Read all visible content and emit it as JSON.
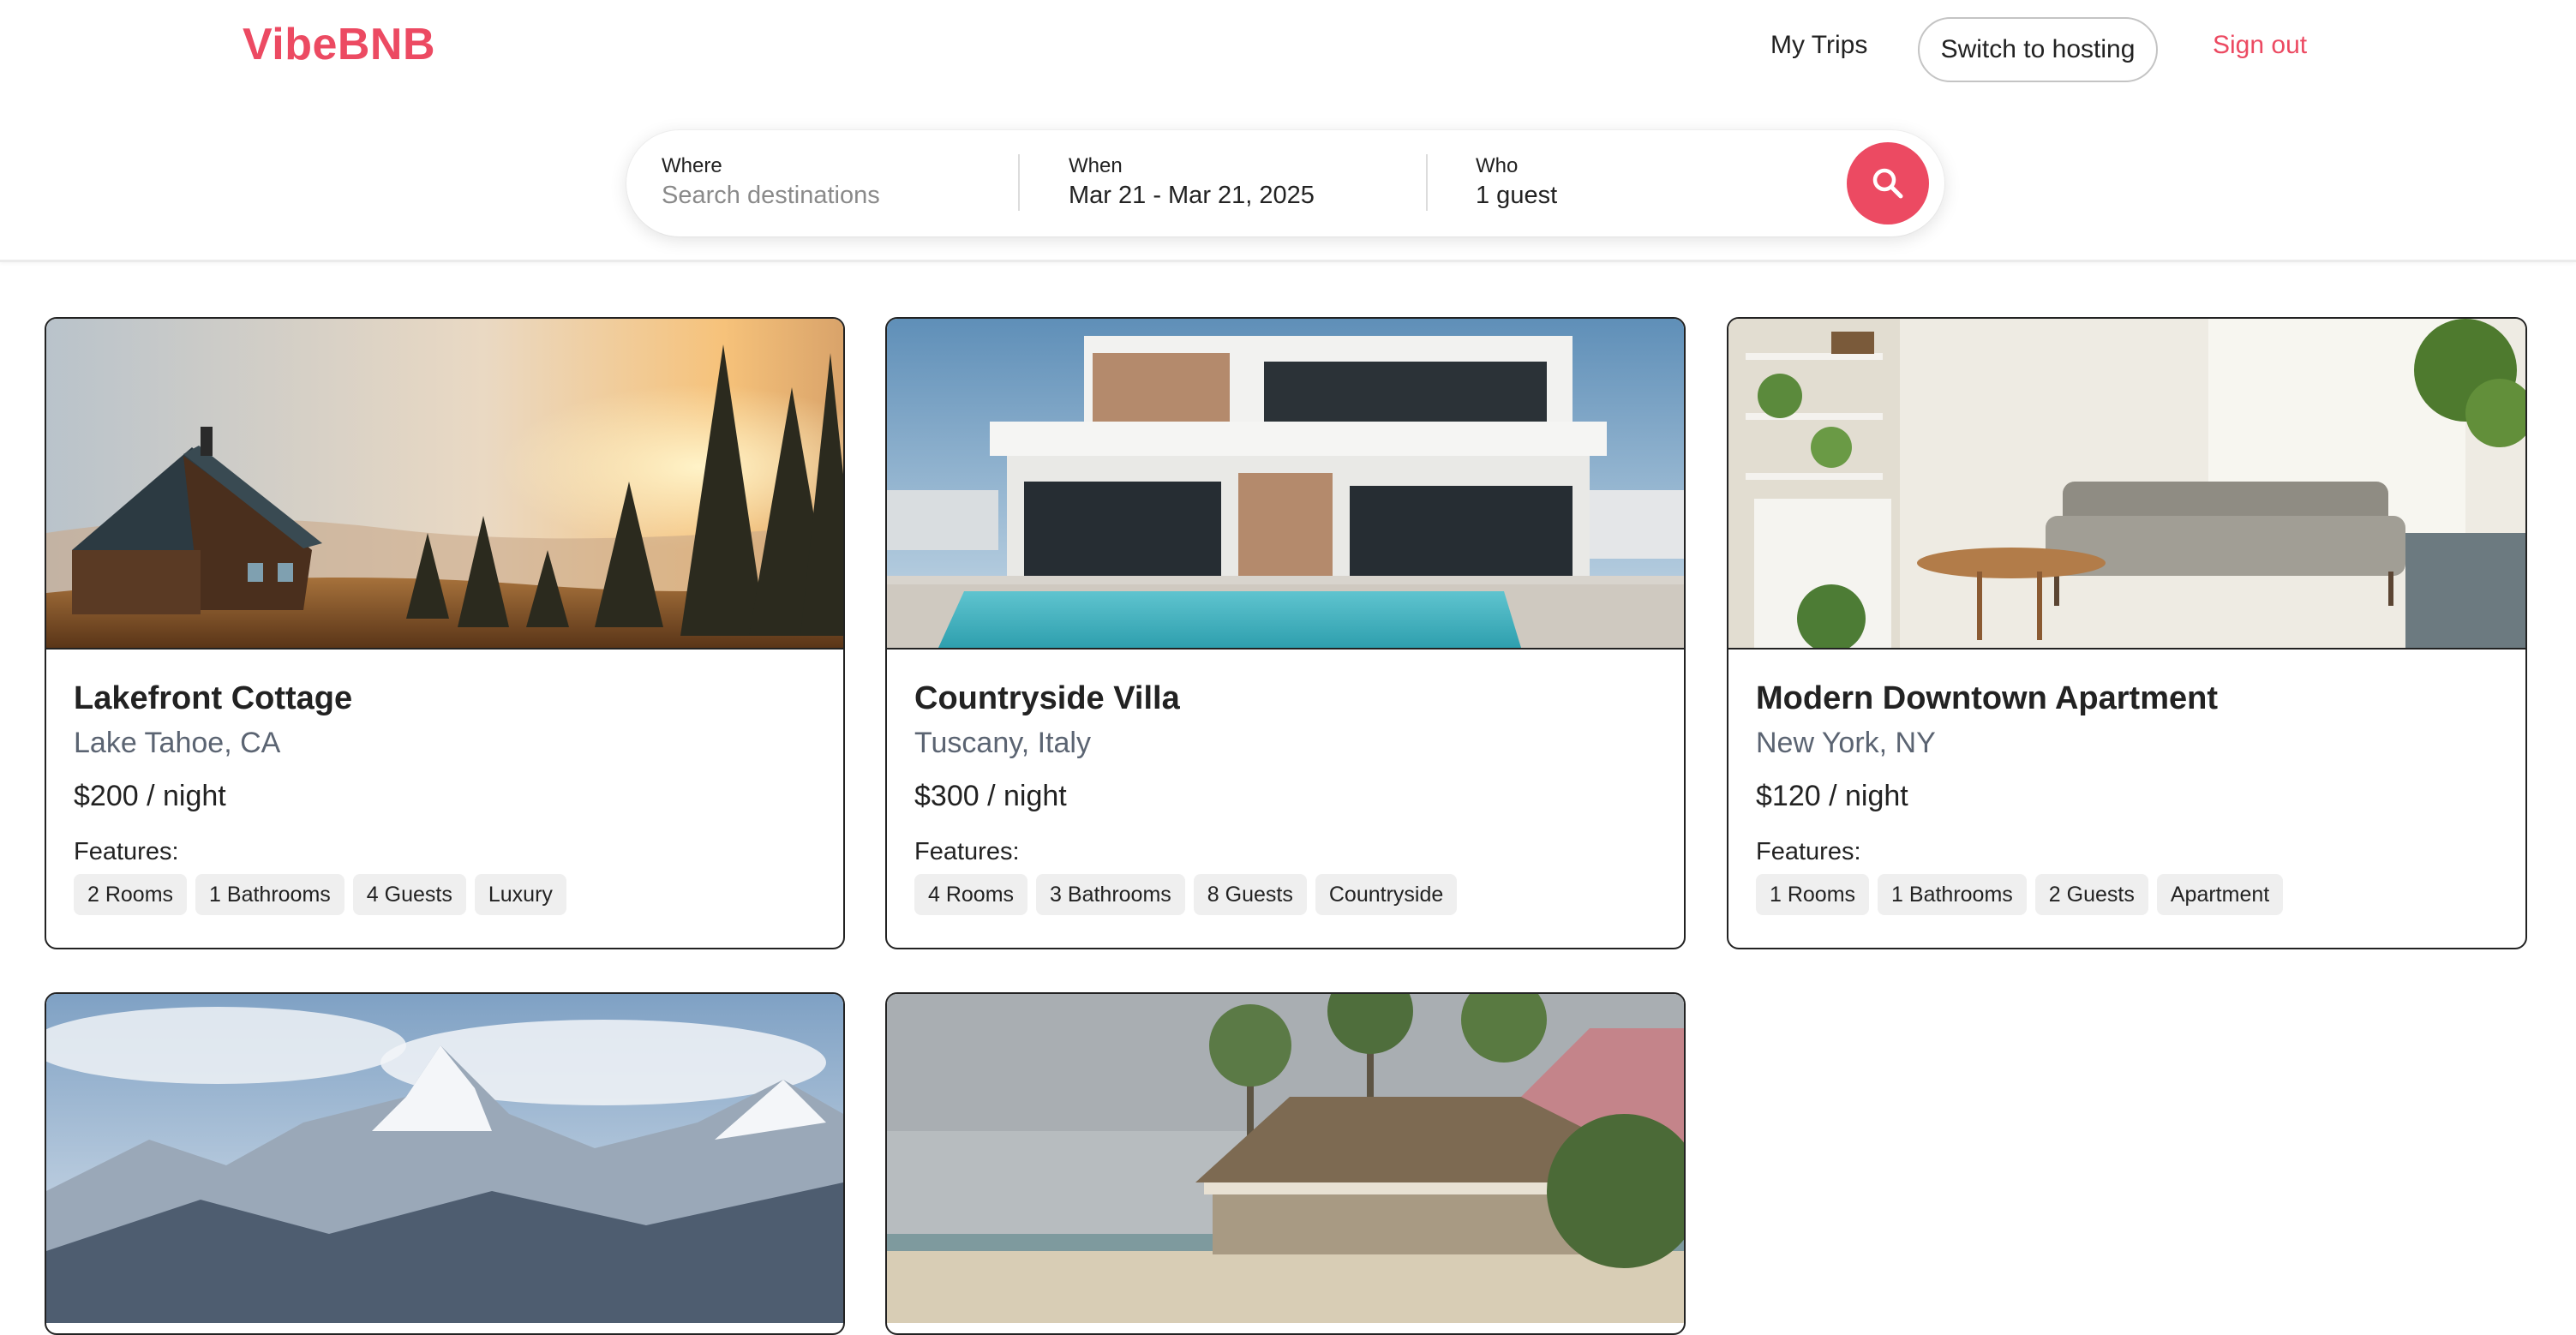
{
  "app": {
    "logo": "VibeBNB"
  },
  "nav": {
    "trips": "My Trips",
    "switch_hosting": "Switch to hosting",
    "sign_out": "Sign out"
  },
  "search": {
    "where_label": "Where",
    "where_placeholder": "Search destinations",
    "when_label": "When",
    "when_value": "Mar 21 - Mar 21, 2025",
    "who_label": "Who",
    "who_value": "1 guest",
    "button_icon": "search-icon"
  },
  "features_label": "Features:",
  "listings": [
    {
      "title": "Lakefront Cottage",
      "location": "Lake Tahoe, CA",
      "price": "$200 / night",
      "tags": [
        "2 Rooms",
        "1 Bathrooms",
        "4 Guests",
        "Luxury"
      ],
      "image": "cabin-at-sunset-photo"
    },
    {
      "title": "Countryside Villa",
      "location": "Tuscany, Italy",
      "price": "$300 / night",
      "tags": [
        "4 Rooms",
        "3 Bathrooms",
        "8 Guests",
        "Countryside"
      ],
      "image": "modern-villa-with-pool-photo"
    },
    {
      "title": "Modern Downtown Apartment",
      "location": "New York, NY",
      "price": "$120 / night",
      "tags": [
        "1 Rooms",
        "1 Bathrooms",
        "2 Guests",
        "Apartment"
      ],
      "image": "living-room-photo"
    },
    {
      "image": "snowy-mountains-photo"
    },
    {
      "image": "beach-bungalow-photo"
    }
  ],
  "colors": {
    "brand": "#ec4a62",
    "text": "#222222",
    "muted": "#5b6472",
    "tag_bg": "#efefef"
  }
}
